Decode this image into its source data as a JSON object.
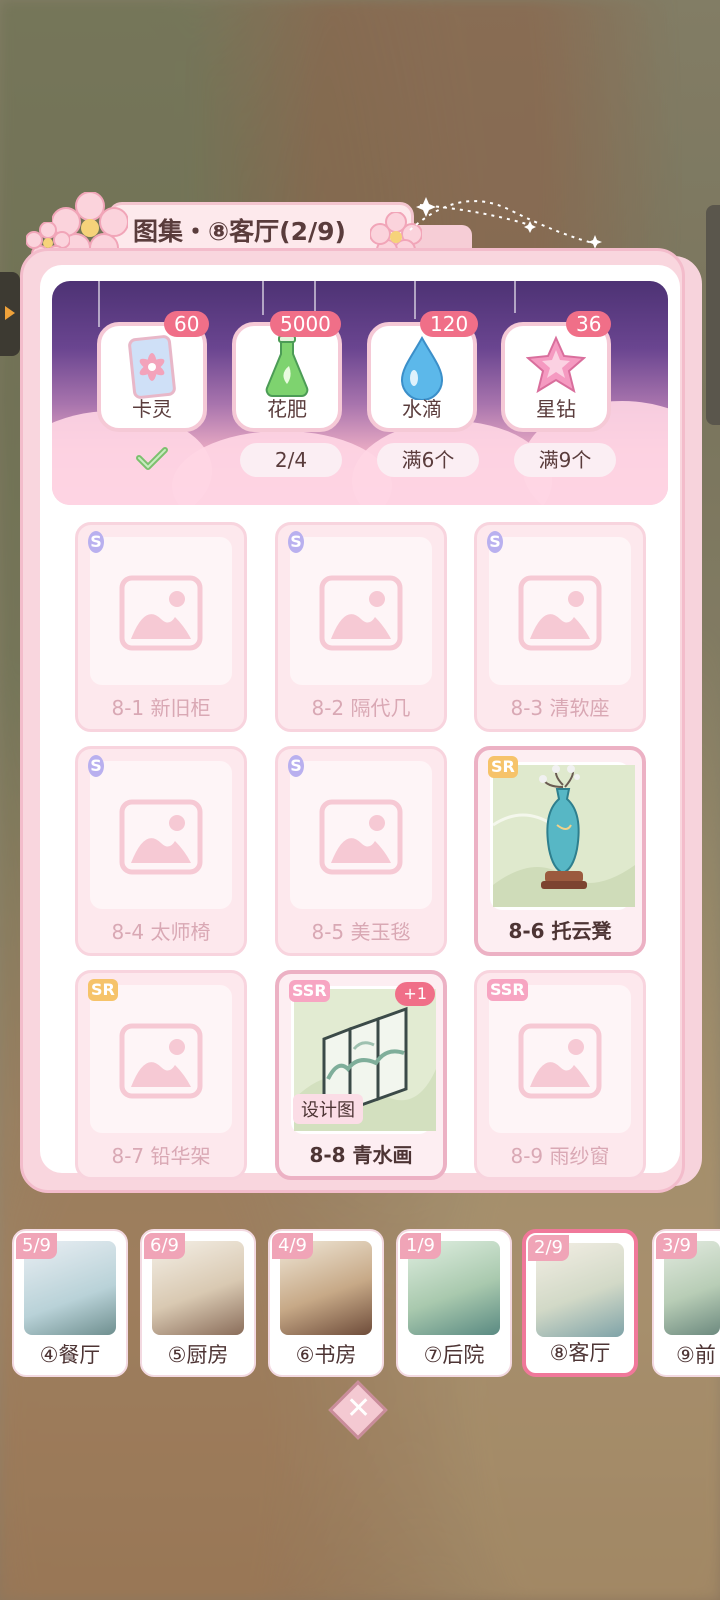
{
  "header": {
    "title": "图集・⑧客厅(2/9)"
  },
  "rewards": [
    {
      "label": "卡灵",
      "count": "60",
      "progress": "",
      "claimed": true,
      "icon": "card-spirit-icon"
    },
    {
      "label": "花肥",
      "count": "5000",
      "progress": "2/4",
      "claimed": false,
      "icon": "fertilizer-flask-icon"
    },
    {
      "label": "水滴",
      "count": "120",
      "progress": "满6个",
      "claimed": false,
      "icon": "water-drop-icon"
    },
    {
      "label": "星钻",
      "count": "36",
      "progress": "满9个",
      "claimed": false,
      "icon": "star-diamond-icon"
    }
  ],
  "items": [
    {
      "rarity": "S",
      "name": "8-1 新旧柜",
      "owned": false
    },
    {
      "rarity": "S",
      "name": "8-2 隔代几",
      "owned": false
    },
    {
      "rarity": "S",
      "name": "8-3 清软座",
      "owned": false
    },
    {
      "rarity": "S",
      "name": "8-4 太师椅",
      "owned": false
    },
    {
      "rarity": "S",
      "name": "8-5 美玉毯",
      "owned": false
    },
    {
      "rarity": "SR",
      "name": "8-6 托云凳",
      "owned": true
    },
    {
      "rarity": "SR",
      "name": "8-7 铅华架",
      "owned": false
    },
    {
      "rarity": "SSR",
      "name": "8-8 青水画",
      "owned": true,
      "badge": "+1",
      "tag": "设计图"
    },
    {
      "rarity": "SSR",
      "name": "8-9 雨纱窗",
      "owned": false
    }
  ],
  "chapters": [
    {
      "count": "5/9",
      "name": "④餐厅"
    },
    {
      "count": "6/9",
      "name": "⑤厨房"
    },
    {
      "count": "4/9",
      "name": "⑥书房"
    },
    {
      "count": "1/9",
      "name": "⑦后院"
    },
    {
      "count": "2/9",
      "name": "⑧客厅",
      "active": true
    },
    {
      "count": "3/9",
      "name": "⑨前"
    }
  ],
  "colors": {
    "accent": "#f06f88",
    "panel": "#f9d6de",
    "banner_top": "#4d3274"
  }
}
